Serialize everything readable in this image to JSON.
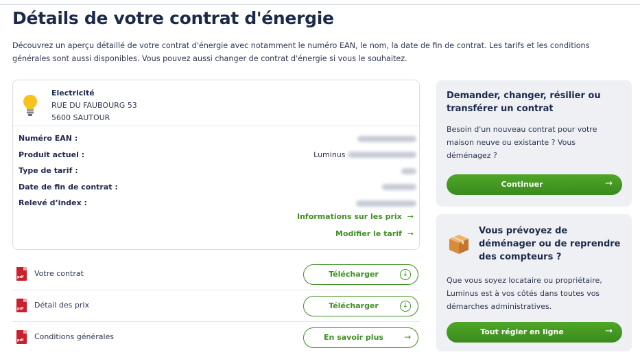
{
  "page": {
    "title": "Détails de votre contrat d'énergie",
    "intro": "Découvrez un aperçu détaillé de votre contrat d'énergie avec notamment le numéro EAN, le nom, la date de fin de contrat. Les tarifs et les conditions générales sont aussi disponibles. Vous pouvez aussi changer de contrat d'énergie si vous le souhaitez."
  },
  "contract": {
    "energy": "Electricité",
    "address_line1": "RUE DU FAUBOURG 53",
    "address_line2": "5600 SAUTOUR",
    "icon": "lightbulb-icon",
    "fields": [
      {
        "label": "Numéro EAN :",
        "value": ""
      },
      {
        "label": "Produit actuel :",
        "value": "Luminus"
      },
      {
        "label": "Type de tarif :",
        "value": ""
      },
      {
        "label": "Date de fin de contrat :",
        "value": ""
      },
      {
        "label": "Relevé d’index :",
        "value": ""
      }
    ],
    "links": {
      "prices": "Informations sur les prix",
      "modify": "Modifier le tarif"
    }
  },
  "documents": [
    {
      "label": "Votre contrat",
      "button": "Télécharger",
      "icon": "download-icon"
    },
    {
      "label": "Détail des prix",
      "button": "Télécharger",
      "icon": "download-icon"
    },
    {
      "label": "Conditions générales",
      "button": "En savoir plus",
      "icon": "arrow-right-icon"
    }
  ],
  "pdf_badge": "pdf",
  "side_cards": {
    "change": {
      "title": "Demander, changer, résilier ou transférer un contrat",
      "text": "Besoin d'un nouveau contrat pour votre maison neuve ou existante ? Vous déménagez ?",
      "button": "Continuer"
    },
    "move": {
      "title": "Vous prévoyez de déménager ou de reprendre des compteurs ?",
      "text": "Que vous soyez locataire ou propriétaire, Luminus est à vos côtés dans toutes vos démarches administratives.",
      "button": "Tout régler en ligne",
      "icon": "moving-box-icon"
    }
  },
  "colors": {
    "accent_green": "#3f8f22",
    "title_navy": "#1c2a4a",
    "side_bg": "#eef0f4",
    "pdf_red": "#c8202c"
  }
}
